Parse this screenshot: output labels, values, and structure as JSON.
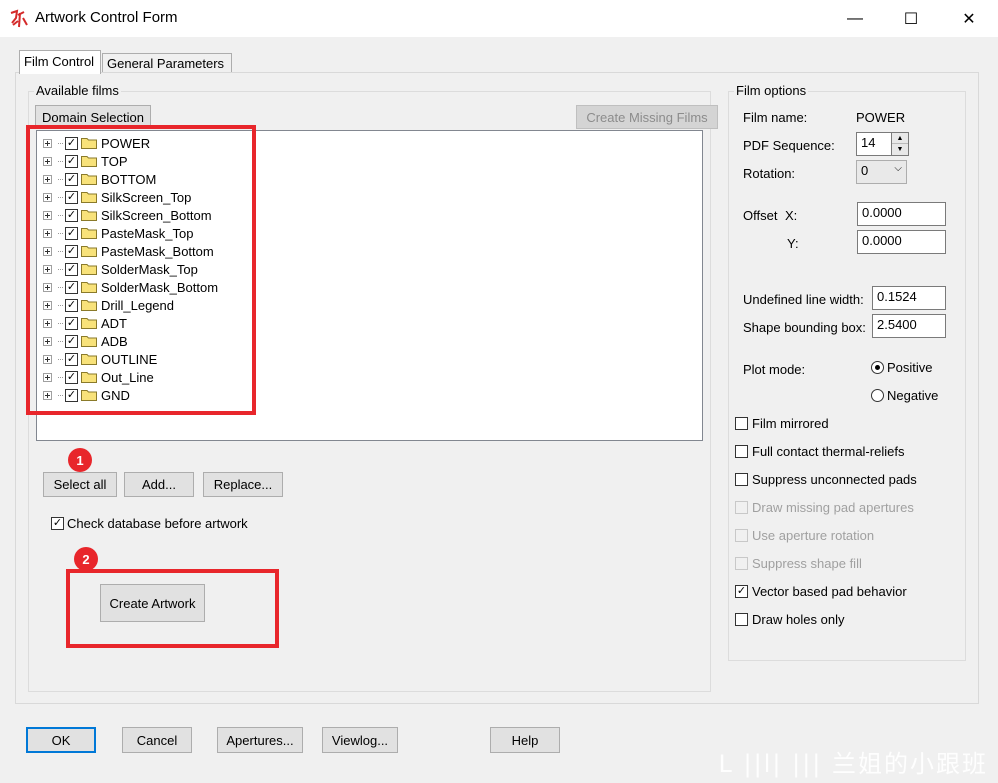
{
  "window": {
    "title": "Artwork Control Form",
    "minimize": "—",
    "maximize": "☐",
    "close": "✕"
  },
  "tabs": [
    {
      "label": "Film Control",
      "active": true
    },
    {
      "label": "General Parameters",
      "active": false
    }
  ],
  "available_films": {
    "group_label": "Available films",
    "domain_selection": "Domain Selection",
    "create_missing": "Create Missing Films",
    "films": [
      {
        "label": "POWER",
        "checked": true
      },
      {
        "label": "TOP",
        "checked": true
      },
      {
        "label": "BOTTOM",
        "checked": true
      },
      {
        "label": "SilkScreen_Top",
        "checked": true
      },
      {
        "label": "SilkScreen_Bottom",
        "checked": true
      },
      {
        "label": "PasteMask_Top",
        "checked": true
      },
      {
        "label": "PasteMask_Bottom",
        "checked": true
      },
      {
        "label": "SolderMask_Top",
        "checked": true
      },
      {
        "label": "SolderMask_Bottom",
        "checked": true
      },
      {
        "label": "Drill_Legend",
        "checked": true
      },
      {
        "label": "ADT",
        "checked": true
      },
      {
        "label": "ADB",
        "checked": true
      },
      {
        "label": "OUTLINE",
        "checked": true
      },
      {
        "label": "Out_Line",
        "checked": true
      },
      {
        "label": "GND",
        "checked": true
      }
    ],
    "select_all": "Select all",
    "add": "Add...",
    "replace": "Replace...",
    "check_db": {
      "label": "Check database before artwork",
      "checked": true
    },
    "create_artwork": "Create Artwork"
  },
  "annotations": {
    "badge1": "1",
    "badge2": "2",
    "color": "#e8262b"
  },
  "film_options": {
    "group_label": "Film options",
    "film_name_label": "Film name:",
    "film_name_value": "POWER",
    "pdf_sequence_label": "PDF Sequence:",
    "pdf_sequence_value": "14",
    "rotation_label": "Rotation:",
    "rotation_value": "0",
    "offset_label": "Offset",
    "offset_x_label": "X:",
    "offset_x_value": "0.0000",
    "offset_y_label": "Y:",
    "offset_y_value": "0.0000",
    "undefined_line_width_label": "Undefined line width:",
    "undefined_line_width_value": "0.1524",
    "shape_bounding_box_label": "Shape bounding box:",
    "shape_bounding_box_value": "2.5400",
    "plot_mode_label": "Plot mode:",
    "plot_positive": "Positive",
    "plot_negative": "Negative",
    "plot_mode_selected": "Positive",
    "checkboxes": [
      {
        "label": "Film mirrored",
        "checked": false,
        "enabled": true
      },
      {
        "label": "Full contact thermal-reliefs",
        "checked": false,
        "enabled": true
      },
      {
        "label": "Suppress unconnected pads",
        "checked": false,
        "enabled": true
      },
      {
        "label": "Draw missing pad apertures",
        "checked": false,
        "enabled": false
      },
      {
        "label": "Use aperture rotation",
        "checked": false,
        "enabled": false
      },
      {
        "label": "Suppress shape fill",
        "checked": false,
        "enabled": false
      },
      {
        "label": "Vector based pad behavior",
        "checked": true,
        "enabled": true
      },
      {
        "label": "Draw holes only",
        "checked": false,
        "enabled": true
      }
    ]
  },
  "bottom_buttons": {
    "ok": "OK",
    "cancel": "Cancel",
    "apertures": "Apertures...",
    "viewlog": "Viewlog...",
    "help": "Help"
  },
  "watermark": "L ||l| ||| 兰姐的小跟班"
}
